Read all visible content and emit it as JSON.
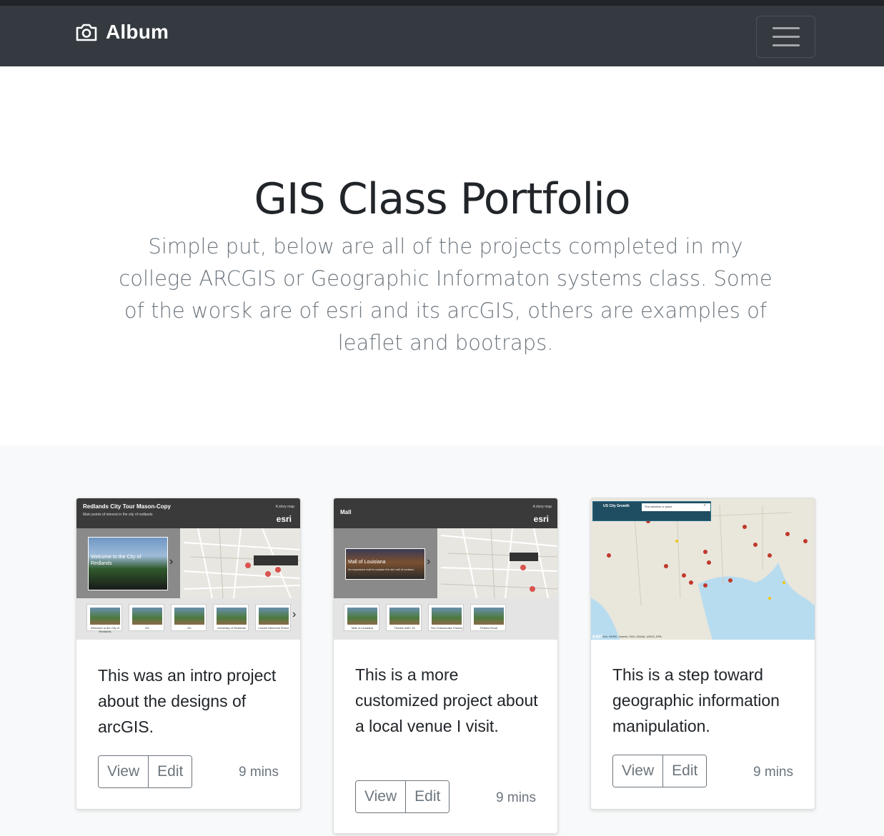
{
  "navbar": {
    "brand": "Album",
    "brand_icon": "camera-icon",
    "toggle_icon": "hamburger-icon"
  },
  "hero": {
    "title": "GIS Class Portfolio",
    "lead": "Simple put, below are all of the projects completed in my college ARCGIS or Geographic Informaton systems class. Some of the worsk are of esri and its arcGIS, others are examples of leaflet and bootraps."
  },
  "cards": [
    {
      "text": "This was an intro project about the designs of arcGIS.",
      "view_label": "View",
      "edit_label": "Edit",
      "time": "9 mins",
      "thumb": {
        "title": "Redlands City Tour Mason-Copy",
        "subtitle": "Main points of interest in the city of redlands",
        "story_label": "A story map",
        "esri": "esri",
        "panel_title": "Welcome to the City of Redlands",
        "tiles": [
          "Welcome to the City of Redlands",
          "Ed",
          "Err",
          "University of Redlands",
          "Lincoln Memorial Shrine"
        ]
      }
    },
    {
      "text": "This is a more customized project about a local venue I visit.",
      "view_label": "View",
      "edit_label": "Edit",
      "time": "9 mins",
      "thumb": {
        "title": "Mall",
        "story_label": "A story map",
        "esri": "esri",
        "panel_title": "Mall of Louisiana",
        "panel_sub": "An expansive mall to replace the old mall of cortana.",
        "tiles": [
          "Mall of Louisiana",
          "Theatre AMC 16",
          "The Cheesecake Factory",
          "Perkins Road"
        ]
      }
    },
    {
      "text": "This is a step toward geographic information manipulation.",
      "view_label": "View",
      "edit_label": "Edit",
      "time": "9 mins",
      "thumb": {
        "title": "US City Growth",
        "search_placeholder": "Find address or place",
        "attribution": "Esri, HERE, Garmin, FAO, NOAA, USGS, EPA",
        "esri": "esri"
      }
    }
  ],
  "colors": {
    "navbar_bg": "#343a40",
    "album_bg": "#f8f9fa",
    "muted": "#6c757d"
  }
}
